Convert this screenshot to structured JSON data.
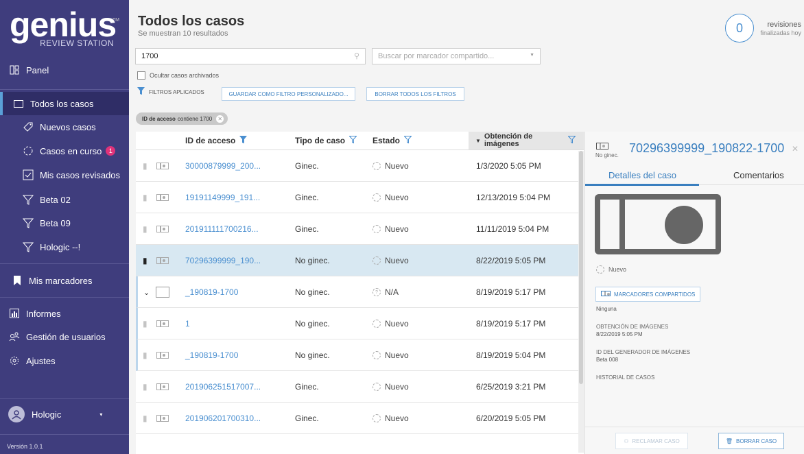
{
  "app": {
    "logo_text": "genius",
    "logo_sub": "REVIEW STATION",
    "logo_tm": "TM"
  },
  "sidebar": {
    "panel": "Panel",
    "items": [
      {
        "label": "Todos los casos",
        "icon": "folder-icon"
      },
      {
        "label": "Nuevos casos",
        "icon": "tag-icon"
      },
      {
        "label": "Casos en curso",
        "icon": "progress-icon",
        "badge": "1"
      },
      {
        "label": "Mis casos revisados",
        "icon": "checkbox-icon"
      },
      {
        "label": "Beta 02",
        "icon": "filter-icon"
      },
      {
        "label": "Beta 09",
        "icon": "filter-icon"
      },
      {
        "label": "Hologic --!",
        "icon": "filter-icon"
      }
    ],
    "bookmarks": "Mis marcadores",
    "reports": "Informes",
    "users": "Gestión de usuarios",
    "settings": "Ajustes",
    "user_name": "Hologic",
    "version": "Versión 1.0.1"
  },
  "header": {
    "title": "Todos los casos",
    "subtitle": "Se muestran 10 resultados",
    "review_count": "0",
    "review_label": "revisiones",
    "review_sub": "finalizadas hoy"
  },
  "search": {
    "value": "1700",
    "tag_placeholder": "Buscar por marcador compartido..."
  },
  "filters": {
    "hide_archived": "Ocultar casos archivados",
    "applied": "FILTROS APLICADOS",
    "save": "GUARDAR COMO FILTRO PERSONALIZADO...",
    "clear": "BORRAR TODOS LOS FILTROS",
    "chip_key": "ID de acceso",
    "chip_val": "contiene 1700"
  },
  "table": {
    "headers": [
      "ID de acceso",
      "Tipo de caso",
      "Estado",
      "Obtención de imágenes"
    ],
    "rows": [
      {
        "id": "30000879999_200...",
        "type": "Ginec.",
        "state": "Nuevo",
        "date": "1/3/2020 5:05 PM"
      },
      {
        "id": "19191149999_191...",
        "type": "Ginec.",
        "state": "Nuevo",
        "date": "12/13/2019 5:04 PM"
      },
      {
        "id": "201911111700216...",
        "type": "Ginec.",
        "state": "Nuevo",
        "date": "11/11/2019 5:04 PM"
      },
      {
        "id": "70296399999_190...",
        "type": "No ginec.",
        "state": "Nuevo",
        "date": "8/22/2019 5:05 PM"
      },
      {
        "id": "_190819-1700",
        "type": "No ginec.",
        "state": "N/A",
        "date": "8/19/2019 5:17 PM"
      },
      {
        "id": "1",
        "type": "No ginec.",
        "state": "Nuevo",
        "date": "8/19/2019 5:17 PM"
      },
      {
        "id": "_190819-1700",
        "type": "No ginec.",
        "state": "Nuevo",
        "date": "8/19/2019 5:04 PM"
      },
      {
        "id": "201906251517007...",
        "type": "Ginec.",
        "state": "Nuevo",
        "date": "6/25/2019 3:21 PM"
      },
      {
        "id": "201906201700310...",
        "type": "Ginec.",
        "state": "Nuevo",
        "date": "6/20/2019 5:05 PM"
      }
    ]
  },
  "panel": {
    "title": "70296399999_190822-1700",
    "type": "No ginec.",
    "tab_details": "Detalles del caso",
    "tab_comments": "Comentarios",
    "state": "Nuevo",
    "shared_btn": "MARCADORES COMPARTIDOS",
    "shared_val": "Ninguna",
    "img_label": "OBTENCIÓN DE IMÁGENES",
    "img_val": "8/22/2019 5:05 PM",
    "gen_label": "ID DEL GENERADOR DE IMÁGENES",
    "gen_val": "Beta 008",
    "history_label": "HISTORIAL DE CASOS",
    "claim": "RECLAMAR CASO",
    "delete": "BORRAR CASO"
  },
  "colors": {
    "sidebar": "#3f3d7d",
    "accent": "#4a8fd0",
    "badge": "#e0337a",
    "selected_row": "#d8e8f2"
  }
}
